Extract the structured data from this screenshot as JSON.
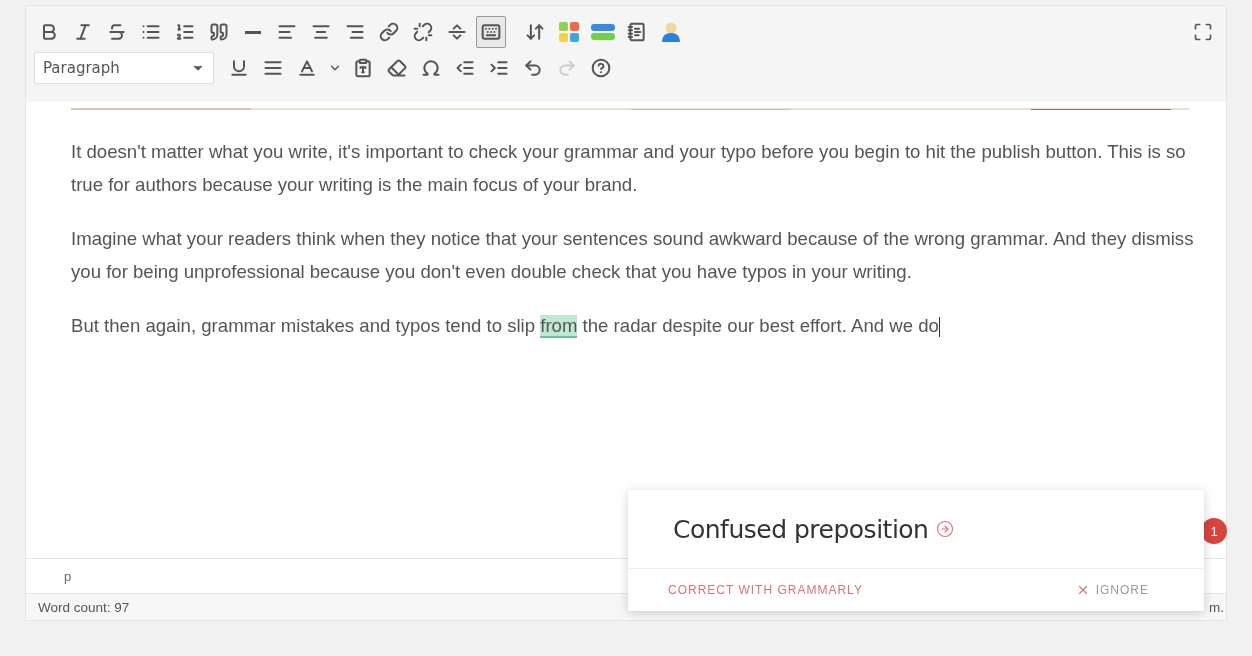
{
  "toolbar": {
    "row_1": [
      {
        "pressed": false
      },
      {
        "pressed": false
      },
      {
        "pressed": false
      },
      {
        "pressed": false
      },
      {
        "pressed": false
      },
      {
        "pressed": false
      },
      {
        "pressed": false
      },
      {
        "pressed": false
      },
      {
        "pressed": false
      },
      {
        "pressed": false
      },
      {
        "pressed": false
      },
      {
        "pressed": false
      },
      {
        "pressed": false
      },
      {
        "pressed": true
      },
      {
        "pressed": false
      },
      {
        "pressed": false
      },
      {
        "pressed": false
      },
      {
        "pressed": false
      },
      {
        "pressed": false
      }
    ],
    "format_select": {
      "value": "Paragraph"
    },
    "row_2": [
      {
        "disabled": false
      },
      {
        "disabled": false
      },
      {
        "disabled": false
      },
      {
        "disabled": false
      },
      {
        "disabled": false
      },
      {
        "disabled": false
      },
      {
        "disabled": false
      },
      {
        "disabled": false
      },
      {
        "disabled": false
      },
      {
        "disabled": false
      },
      {
        "disabled": true
      },
      {
        "disabled": false
      }
    ]
  },
  "content": {
    "paragraphs": [
      {
        "before": "It doesn't matter what you write, it's important to check your grammar and your typo before you begin to hit the publish button. This is so true for authors because your writing is the main focus of your brand."
      },
      {
        "before": "Imagine what your readers think when they notice that your sentences sound awkward because of the wrong grammar. And they dismiss you for being unprofessional because you don't even double check that you have typos in your writing."
      },
      {
        "before": "But then again, grammar mistakes and typos tend to slip ",
        "flagged": "from",
        "after": " the radar despite our best effort. And we do"
      }
    ]
  },
  "issue_badge": "1",
  "path_bar": "p",
  "status_bar": {
    "word_count": "Word count: 97",
    "right_text": "m."
  },
  "suggestion_popup": {
    "title": "Confused preposition",
    "correct_action": "CORRECT WITH GRAMMARLY",
    "ignore_action": "IGNORE"
  }
}
